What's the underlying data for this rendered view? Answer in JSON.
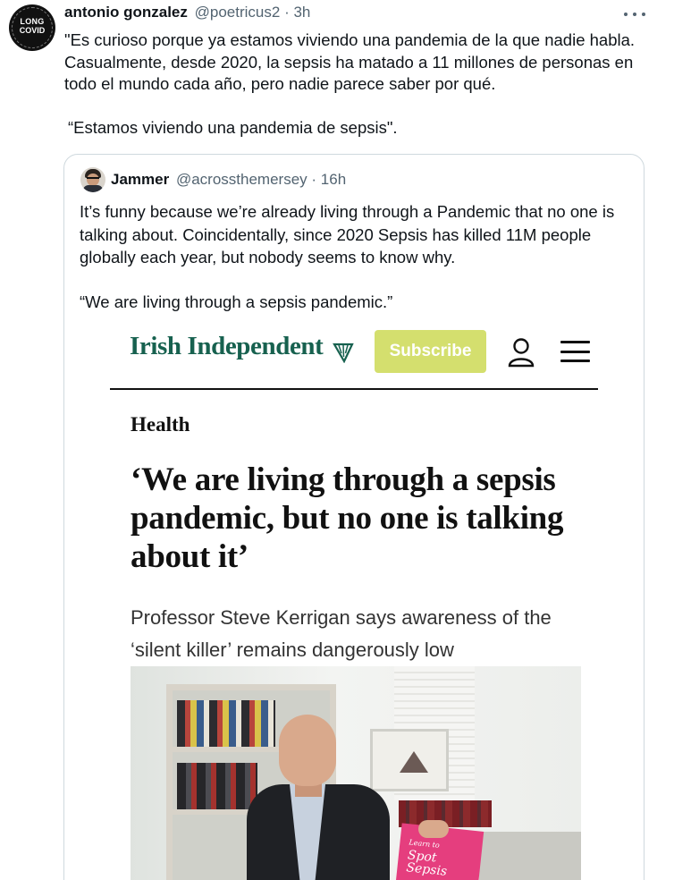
{
  "tweet": {
    "author_name": "antonio gonzalez",
    "author_handle": "@poetricus2",
    "separator": "·",
    "time": "3h",
    "avatar_lines": [
      "LONG",
      "COVID"
    ],
    "text_p1": "\"Es curioso porque ya estamos viviendo una pandemia de la que nadie habla. Casualmente, desde 2020, la sepsis ha matado a 11 millones de personas en todo el mundo cada año, pero nadie parece saber por qué.",
    "text_p2": "“Estamos viviendo una pandemia de sepsis\"."
  },
  "quoted": {
    "author_name": "Jammer",
    "author_handle": "@acrossthemersey",
    "separator": "·",
    "time": "16h",
    "text_p1": "It’s funny because we’re already living through a Pandemic that no one is talking about.  Coincidentally, since 2020 Sepsis has killed 11M people globally each year, but nobody seems to know why.",
    "text_p2": "“We are living through a sepsis pandemic.”"
  },
  "article": {
    "logo": "Irish Independent",
    "subscribe_label": "Subscribe",
    "section": "Health",
    "headline": "‘We are living through a sepsis pandemic, but no one is talking about it’",
    "standfirst": "Professor Steve Kerrigan says awareness of the ‘silent killer’ remains dangerously low",
    "leaflet_small": "Learn to",
    "leaflet_big": "Spot Sepsis"
  },
  "colors": {
    "logo_green": "#17614f",
    "subscribe_bg": "#d4df6e",
    "handle_gray": "#536471",
    "card_border": "#cfd9de"
  },
  "icons": [
    "more-icon",
    "harp-icon",
    "user-icon",
    "menu-icon"
  ]
}
